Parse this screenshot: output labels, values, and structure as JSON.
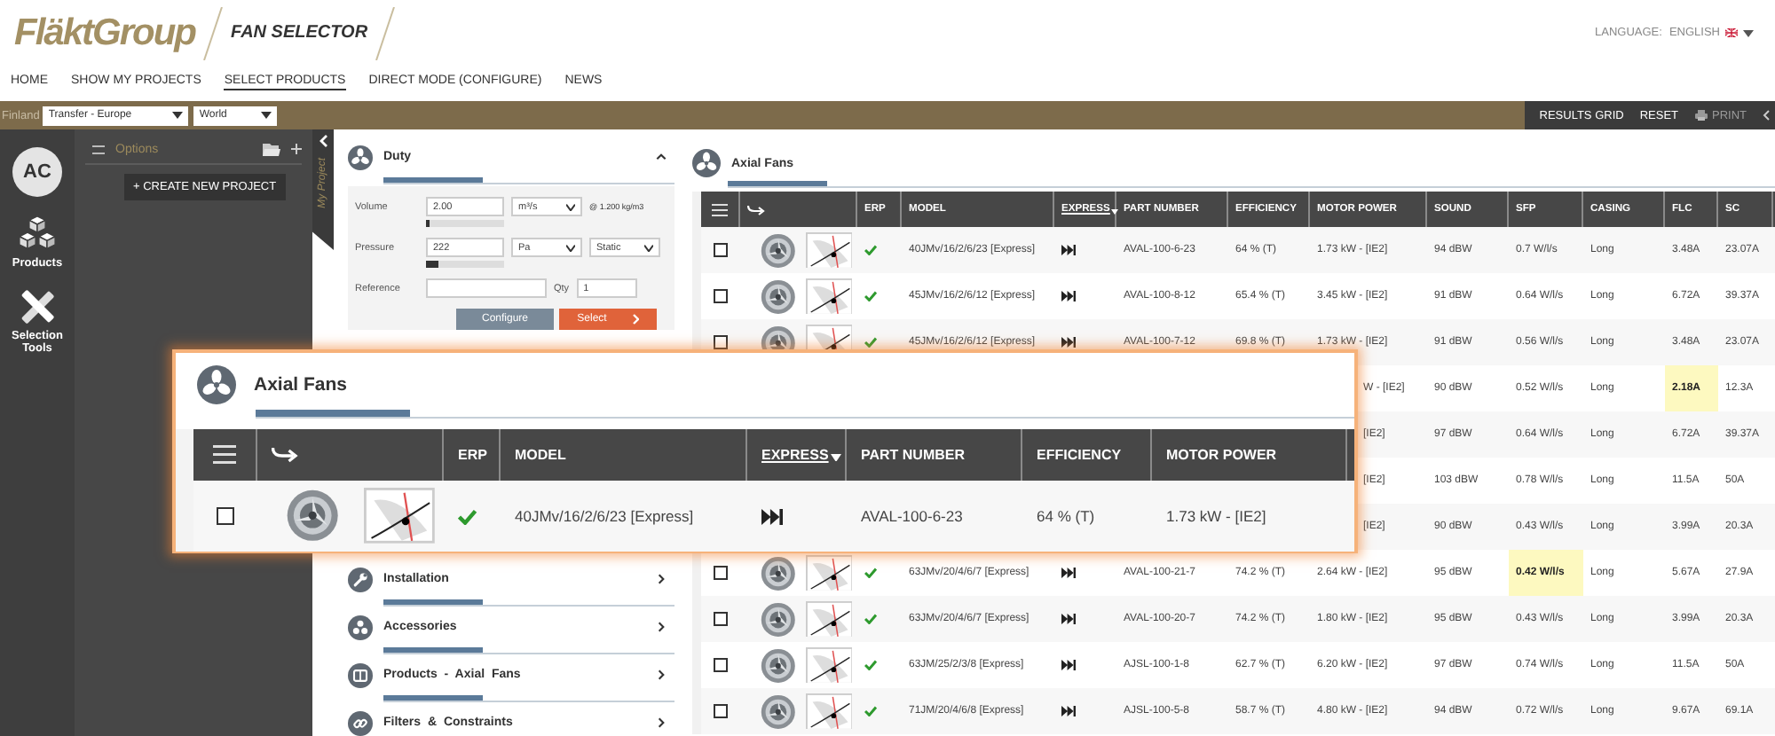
{
  "header": {
    "brand": "FläktGroup",
    "product": "FAN SELECTOR",
    "language_label": "LANGUAGE:",
    "language": "ENGLISH"
  },
  "nav": [
    {
      "label": "HOME",
      "selected": false
    },
    {
      "label": "SHOW MY PROJECTS",
      "selected": false
    },
    {
      "label": "SELECT PRODUCTS",
      "selected": true
    },
    {
      "label": "DIRECT MODE (CONFIGURE)",
      "selected": false
    },
    {
      "label": "NEWS",
      "selected": false
    }
  ],
  "toolbar": {
    "country": "Finland",
    "region": "Transfer - Europe",
    "scope": "World",
    "actions": [
      {
        "label": "RESULTS GRID",
        "kind": "text",
        "disabled": false
      },
      {
        "label": "RESET",
        "kind": "text",
        "disabled": false
      },
      {
        "label": "PRINT",
        "kind": "print",
        "disabled": true
      }
    ]
  },
  "rail": {
    "avatar": "AC",
    "items": [
      {
        "label": "Products",
        "kind": "products"
      },
      {
        "label": "Selection Tools",
        "kind": "tools"
      }
    ]
  },
  "options": {
    "title": "Options",
    "create_button": "+ CREATE NEW PROJECT"
  },
  "my_project_tab": "My Project",
  "duty": {
    "title": "Duty",
    "expanded": true,
    "volume": {
      "label": "Volume",
      "value": "2.00",
      "unit": "m³/s",
      "note": "@ 1.200 kg/m3",
      "level": 0.04
    },
    "pressure": {
      "label": "Pressure",
      "value": "222",
      "unit": "Pa",
      "mode": "Static",
      "level": 0.15
    },
    "reference": {
      "label": "Reference",
      "qty_label": "Qty",
      "qty": "1"
    },
    "buttons": [
      {
        "label": "Configure",
        "kind": "secondary"
      },
      {
        "label": "Select",
        "kind": "primary"
      }
    ]
  },
  "sections": [
    {
      "title": "Installation",
      "kind": "wrench",
      "expanded": false
    },
    {
      "title": "Accessories",
      "kind": "accessories",
      "expanded": false
    },
    {
      "title": "Products - Axial Fans",
      "kind": "products",
      "expanded": false
    },
    {
      "title": "Filters & Constraints",
      "kind": "link",
      "expanded": false
    }
  ],
  "results": {
    "title": "Axial Fans",
    "columns": [
      {
        "kind": "menu"
      },
      {
        "kind": "link"
      },
      {
        "kind": "erp",
        "label": "ERP",
        "sorted": false
      },
      {
        "kind": "text",
        "label": "MODEL",
        "sorted": false
      },
      {
        "kind": "express",
        "label": "EXPRESS",
        "sorted": true
      },
      {
        "kind": "text",
        "label": "PART NUMBER",
        "sorted": false
      },
      {
        "kind": "text",
        "label": "EFFICIENCY",
        "sorted": false
      },
      {
        "kind": "text",
        "label": "MOTOR POWER",
        "sorted": false
      },
      {
        "kind": "text",
        "label": "SOUND",
        "sorted": false
      },
      {
        "kind": "text",
        "label": "SFP",
        "sorted": false
      },
      {
        "kind": "text",
        "label": "CASING",
        "sorted": false
      },
      {
        "kind": "text",
        "label": "FLC",
        "sorted": false
      },
      {
        "kind": "text",
        "label": "SC",
        "sorted": false
      }
    ],
    "rows": [
      {
        "checked": false,
        "erp": true,
        "express": true,
        "cells": [
          "",
          "",
          "",
          "40JMv/16/2/6/23 [Express]",
          "",
          "AVAL-100-6-23",
          "64 % (T)",
          "1.73 kW - [IE2]",
          "94 dBW",
          "0.7 W/l/s",
          "Long",
          "3.48A",
          "23.07A"
        ]
      },
      {
        "checked": false,
        "erp": true,
        "express": true,
        "cells": [
          "",
          "",
          "",
          "45JMv/16/2/6/12 [Express]",
          "",
          "AVAL-100-8-12",
          "65.4 % (T)",
          "3.45 kW - [IE2]",
          "91 dBW",
          "0.64 W/l/s",
          "Long",
          "6.72A",
          "39.37A"
        ]
      },
      {
        "checked": false,
        "erp": true,
        "express": true,
        "cells": [
          "",
          "",
          "",
          "45JMv/16/2/6/12 [Express]",
          "",
          "AVAL-100-7-12",
          "69.8 % (T)",
          "1.73 kW - [IE2]",
          "91 dBW",
          "0.56 W/l/s",
          "Long",
          "3.48A",
          "23.07A"
        ]
      },
      {
        "covered": true,
        "cells": [
          "",
          "",
          "",
          "",
          "",
          "",
          "",
          "W - [IE2]",
          "90 dBW",
          "0.52 W/l/s",
          "Long",
          {
            "text": "2.18A",
            "highlighted": true
          },
          "12.3A"
        ]
      },
      {
        "covered": true,
        "cells": [
          "",
          "",
          "",
          "",
          "",
          "",
          "",
          "[IE2]",
          "97 dBW",
          "0.64 W/l/s",
          "Long",
          "6.72A",
          "39.37A"
        ]
      },
      {
        "covered": true,
        "cells": [
          "",
          "",
          "",
          "",
          "",
          "",
          "",
          "[IE2]",
          "103 dBW",
          "0.78 W/l/s",
          "Long",
          "11.5A",
          "50A"
        ]
      },
      {
        "covered": true,
        "cells": [
          "",
          "",
          "",
          "",
          "",
          "",
          "",
          "[IE2]",
          "90 dBW",
          "0.43 W/l/s",
          "Long",
          "3.99A",
          "20.3A"
        ]
      },
      {
        "checked": false,
        "erp": true,
        "express": true,
        "cells": [
          "",
          "",
          "",
          "63JMv/20/4/6/7 [Express]",
          "",
          "AVAL-100-21-7",
          "74.2 % (T)",
          "2.64 kW - [IE2]",
          "95 dBW",
          {
            "text": "0.42 W/l/s",
            "highlighted": true
          },
          "Long",
          "5.67A",
          "27.9A"
        ]
      },
      {
        "checked": false,
        "erp": true,
        "express": true,
        "cells": [
          "",
          "",
          "",
          "63JMv/20/4/6/7 [Express]",
          "",
          "AVAL-100-20-7",
          "74.2 % (T)",
          "1.80 kW - [IE2]",
          "95 dBW",
          "0.43 W/l/s",
          "Long",
          "3.99A",
          "20.3A"
        ]
      },
      {
        "checked": false,
        "erp": true,
        "express": true,
        "cells": [
          "",
          "",
          "",
          "63JM/25/2/3/8 [Express]",
          "",
          "AJSL-100-1-8",
          "62.7 % (T)",
          "6.20 kW - [IE2]",
          "97 dBW",
          "0.74 W/l/s",
          "Long",
          "11.5A",
          "50A"
        ]
      },
      {
        "checked": false,
        "erp": true,
        "express": true,
        "cells": [
          "",
          "",
          "",
          "71JM/20/4/6/8 [Express]",
          "",
          "AJSL-100-5-8",
          "58.7 % (T)",
          "4.80 kW - [IE2]",
          "94 dBW",
          "0.72 W/l/s",
          "Long",
          "9.67A",
          "69.1A"
        ]
      }
    ]
  },
  "callout": {
    "title": "Axial Fans",
    "columns": [
      {
        "kind": "menu"
      },
      {
        "kind": "link"
      },
      {
        "kind": "erp",
        "label": "ERP",
        "sorted": false
      },
      {
        "kind": "text",
        "label": "MODEL",
        "sorted": false
      },
      {
        "kind": "express",
        "label": "EXPRESS",
        "sorted": true
      },
      {
        "kind": "text",
        "label": "PART NUMBER",
        "sorted": false
      },
      {
        "kind": "text",
        "label": "EFFICIENCY",
        "sorted": false
      },
      {
        "kind": "text",
        "label": "MOTOR POWER",
        "sorted": false
      }
    ],
    "rows": [
      {
        "checked": false,
        "erp": true,
        "express": true,
        "cells": [
          "",
          "",
          "",
          "40JMv/16/2/6/23 [Express]",
          "",
          "AVAL-100-6-23",
          "64 % (T)",
          "1.73 kW - [IE2]"
        ]
      }
    ]
  }
}
